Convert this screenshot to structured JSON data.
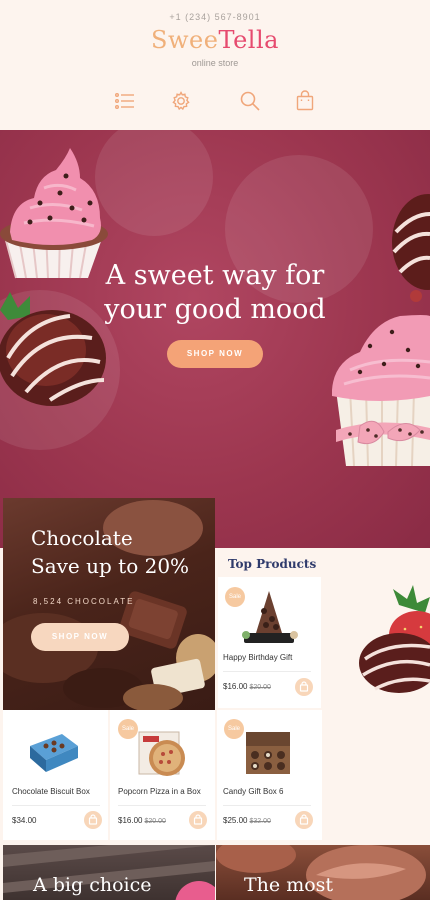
{
  "header": {
    "phone": "+1 (234) 567-8901",
    "logo_part1": "Swee",
    "logo_part2": "Tella",
    "tagline": "online store"
  },
  "nav": [
    {
      "icon": "menu-icon"
    },
    {
      "icon": "gear-icon"
    },
    {
      "icon": "search-icon"
    },
    {
      "icon": "shopping-bag-icon"
    }
  ],
  "hero": {
    "title_line1": "A sweet way for",
    "title_line2": "your good mood",
    "button": "SHOP NOW"
  },
  "promo": {
    "title_line1": "Chocolate",
    "title_line2": "Save up to 20%",
    "subtitle": "8,524 CHOCOLATE",
    "button": "SHOP NOW"
  },
  "top_products": {
    "title": "Top Products",
    "featured": {
      "name": "Happy Birthday Gift",
      "price": "$16.00",
      "old_price": "$20.00",
      "sale": "Sale"
    }
  },
  "products": [
    {
      "name": "Chocolate Biscuit Box",
      "price": "$34.00",
      "old_price": "",
      "sale": ""
    },
    {
      "name": "Popcorn Pizza in a Box",
      "price": "$16.00",
      "old_price": "$20.00",
      "sale": "Sale"
    },
    {
      "name": "Candy Gift Box 6",
      "price": "$25.00",
      "old_price": "$32.00",
      "sale": "Sale"
    }
  ],
  "banners": [
    {
      "text": "A big choice"
    },
    {
      "text": "The most"
    }
  ],
  "colors": {
    "accent": "#f4a377",
    "logo_pink": "#e64b6f",
    "logo_peach": "#f0b07a",
    "hero_bg": "#9c364f",
    "heading_navy": "#2f3a6b"
  }
}
